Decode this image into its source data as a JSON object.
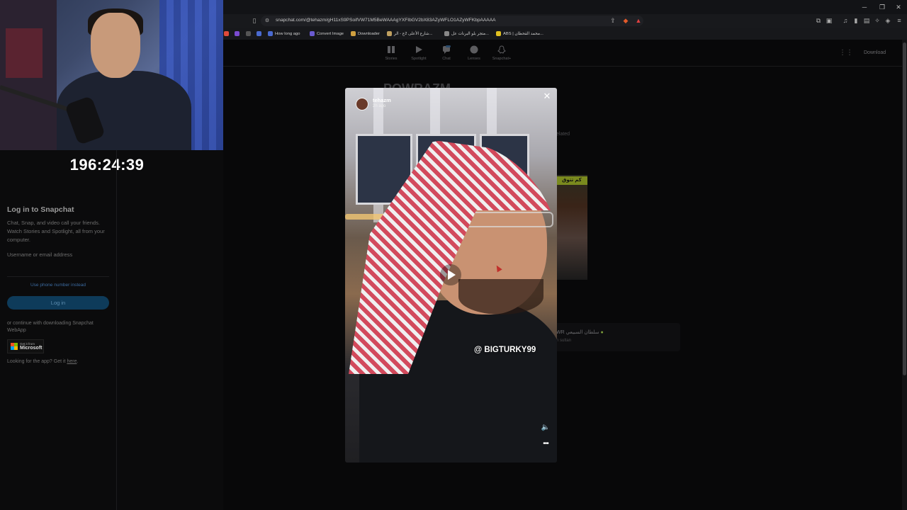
{
  "overlay": {
    "timer": "196:24:39"
  },
  "browser": {
    "url": "snapchat.com/@tehazm/gH11xS9PSoifVW71M5BeWAAAgYXFIbGV2bX83AZyWFLO1AZyWFKbpAAAAA",
    "bookmarks": [
      {
        "label": "How long ago",
        "icon": "clock-icon",
        "color": "#4a6ad0"
      },
      {
        "label": "Convert Image",
        "icon": "image-icon",
        "color": "#6a5ad0"
      },
      {
        "label": "Downloader",
        "icon": "download-icon",
        "color": "#d0a040"
      },
      {
        "label": "شارع الأعلى 2ع - الر...",
        "icon": "site-icon",
        "color": "#c0a060"
      },
      {
        "label": "متجر بلو البرنات عل...",
        "icon": "store-icon",
        "color": "#888888"
      },
      {
        "label": "ABS | محمد القحطان...",
        "icon": "abs-icon",
        "color": "#e0c020"
      }
    ]
  },
  "snap_nav": {
    "items": [
      {
        "label": "Stories"
      },
      {
        "label": "Spotlight"
      },
      {
        "label": "Chat"
      },
      {
        "label": "Lenses"
      },
      {
        "label": "Snapchat+"
      }
    ],
    "download": "Download"
  },
  "login": {
    "title": "Log in to Snapchat",
    "description": "Chat, Snap, and video call your friends. Watch Stories and Spotlight, all from your computer.",
    "username_label": "Username or email address",
    "username_value": "",
    "phone_link": "Use phone number instead",
    "login_button": "Log in",
    "continue_text": "or continue with downloading Snapchat WebApp",
    "ms_badge_small": "Get it from",
    "ms_badge_big": "Microsoft",
    "looking_text": "Looking for the app? Get it ",
    "looking_link": "here",
    "looking_end": "."
  },
  "background_profile": {
    "name": "POWRAZM",
    "related_tab": "elated",
    "thumb_banner": "كم تتوق",
    "card_name": "WR سلطان السبيعي",
    "card_handle": "n sultan"
  },
  "story": {
    "username": "tehazm",
    "time": "2h ago",
    "caption": "@ BIGTURKY99"
  },
  "colors": {
    "accent_blue": "#0e3b5a",
    "ghutra_red": "#d24a5c",
    "verified_green": "#8bc34a"
  }
}
